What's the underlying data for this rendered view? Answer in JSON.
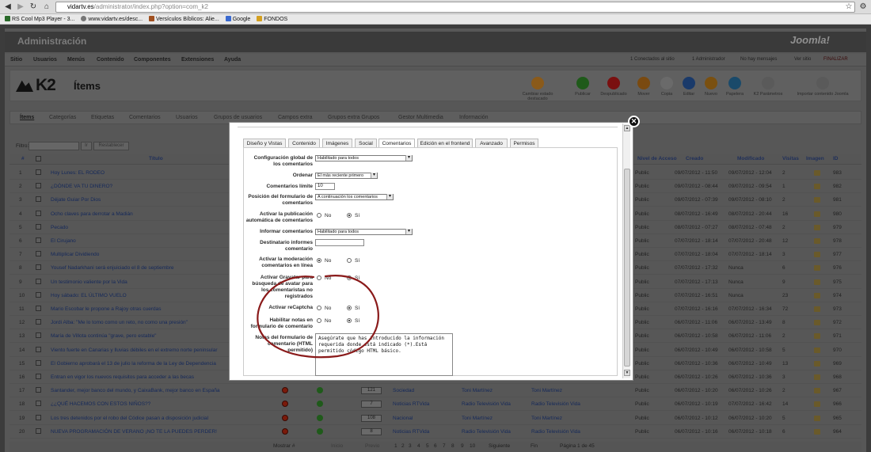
{
  "browser": {
    "url_host": "vidartv.es",
    "url_path": "/administrator/index.php?option=com_k2",
    "back": "◀",
    "forward": "▶",
    "reload": "↻",
    "home": "⌂",
    "star": "☆",
    "wrench": "⚙",
    "bookmarks": [
      "RS Cool Mp3 Player - 3...",
      "www.vidartv.es/desc...",
      "Versículos Bíblicos: Alie...",
      "Google",
      "FONDOS"
    ]
  },
  "admin": {
    "title": "Administración",
    "logo": "Joomla!",
    "menu": [
      "Sitio",
      "Usuarios",
      "Menús",
      "Contenido",
      "Componentes",
      "Extensiones",
      "Ayuda"
    ],
    "status": [
      "1 Conectados al sitio",
      "1 Administrador",
      "No hay mensajes",
      "Ver sitio",
      "FINALIZAR"
    ]
  },
  "k2": {
    "logo": "K2",
    "heading": "Ítems",
    "toolbar": [
      {
        "label": "Cambiar estado destacado",
        "color": "#8a5a1a"
      },
      {
        "label": "Publicar",
        "color": "#1f5a1a"
      },
      {
        "label": "Despublicado",
        "color": "#7a1010"
      },
      {
        "label": "Mover",
        "color": "#7a4a10"
      },
      {
        "label": "Copia",
        "color": "#6a6a6a"
      },
      {
        "label": "Editar",
        "color": "#1a3a6a"
      },
      {
        "label": "Nuevo",
        "color": "#7a5010"
      },
      {
        "label": "Papelera",
        "color": "#1a4a6a"
      },
      {
        "label": "K2 Parámetros",
        "color": "#5a5a5a"
      },
      {
        "label": "Importar contenido Joomla",
        "color": "#5a5a5a"
      }
    ],
    "subnav": [
      "Ítems",
      "Categorías",
      "Etiquetas",
      "Comentarios",
      "Usuarios",
      "Grupos de usuarios",
      "Campos extra",
      "Grupos extra Grupos",
      "Gestor Multimedia",
      "Información"
    ],
    "filter_label": "Filtro:",
    "go": "Ir",
    "reset": "Restablecer"
  },
  "table": {
    "headers": {
      "num": "#",
      "title": "Título",
      "access": "Nivel de Acceso",
      "created": "Creado",
      "modified": "Modificado",
      "hits": "Visitas",
      "image": "Imagen",
      "id": "ID"
    },
    "rows": [
      {
        "n": "1",
        "title": "Hoy Lunes: EL RODEO",
        "access": "Public",
        "created": "09/07/2012 - 11:50",
        "modified": "09/07/2012 - 12:04",
        "hits": "2",
        "id": "983"
      },
      {
        "n": "2",
        "title": "¿DÓNDE VA TU DINERO?",
        "access": "Public",
        "created": "09/07/2012 - 08:44",
        "modified": "09/07/2012 - 09:54",
        "hits": "1",
        "id": "982"
      },
      {
        "n": "3",
        "title": "Déjate Guiar Por Dios",
        "access": "Public",
        "created": "09/07/2012 - 07:39",
        "modified": "09/07/2012 - 08:10",
        "hits": "2",
        "id": "981"
      },
      {
        "n": "4",
        "title": "Ocho claves para derrotar a Madián",
        "access": "Public",
        "created": "08/07/2012 - 16:49",
        "modified": "08/07/2012 - 20:44",
        "hits": "16",
        "id": "980"
      },
      {
        "n": "5",
        "title": "Pecado",
        "access": "Public",
        "created": "08/07/2012 - 07:27",
        "modified": "08/07/2012 - 07:48",
        "hits": "2",
        "id": "979"
      },
      {
        "n": "6",
        "title": "El Cirujano",
        "access": "Public",
        "created": "07/07/2012 - 18:14",
        "modified": "07/07/2012 - 20:48",
        "hits": "12",
        "id": "978"
      },
      {
        "n": "7",
        "title": "Multiplicar Dividiendo",
        "access": "Public",
        "created": "07/07/2012 - 18:04",
        "modified": "07/07/2012 - 18:14",
        "hits": "3",
        "id": "977"
      },
      {
        "n": "8",
        "title": "Yousef Nadarkhani será enjuiciado el 8 de septiembre",
        "access": "Public",
        "created": "07/07/2012 - 17:32",
        "modified": "Nunca",
        "hits": "6",
        "id": "976"
      },
      {
        "n": "9",
        "title": "Un testimonio valiente por la Vida",
        "access": "Public",
        "created": "07/07/2012 - 17:13",
        "modified": "Nunca",
        "hits": "9",
        "id": "975"
      },
      {
        "n": "10",
        "title": "Hoy sábado: EL ÚLTIMO VUELO",
        "access": "Public",
        "created": "07/07/2012 - 16:51",
        "modified": "Nunca",
        "hits": "23",
        "id": "974"
      },
      {
        "n": "11",
        "title": "Mario Escobar le propone a Rajoy otras cuerdas",
        "access": "Public",
        "created": "07/07/2012 - 16:16",
        "modified": "07/07/2012 - 16:34",
        "hits": "72",
        "id": "973"
      },
      {
        "n": "12",
        "title": "Jordi Alba: \"Me lo tomo como un reto, no como una presión\"",
        "access": "Public",
        "created": "06/07/2012 - 11:06",
        "modified": "06/07/2012 - 13:49",
        "hits": "8",
        "id": "972"
      },
      {
        "n": "13",
        "title": "María de Villota continúa \"grave, pero estable\"",
        "access": "Public",
        "created": "06/07/2012 - 10:58",
        "modified": "06/07/2012 - 11:06",
        "hits": "2",
        "id": "971"
      },
      {
        "n": "14",
        "title": "Viento fuerte en Canarias y lluvias débiles en el extremo norte peninsular",
        "access": "Public",
        "created": "06/07/2012 - 10:49",
        "modified": "06/07/2012 - 10:58",
        "hits": "5",
        "id": "970"
      },
      {
        "n": "15",
        "title": "El Gobierno aprobará el 13 de julio la reforma de la Ley de Dependencia",
        "access": "Public",
        "created": "06/07/2012 - 10:36",
        "modified": "06/07/2012 - 10:49",
        "hits": "13",
        "id": "969"
      },
      {
        "n": "16",
        "title": "Entran en vigor los nuevos requisitos para acceder a las becas",
        "access": "Public",
        "created": "06/07/2012 - 10:26",
        "modified": "06/07/2012 - 10:36",
        "hits": "3",
        "id": "968"
      },
      {
        "n": "17",
        "title": "Santander, mejor banco del mundo, y CaixaBank, mejor banco en España",
        "access": "Public",
        "created": "06/07/2012 - 10:20",
        "modified": "06/07/2012 - 10:26",
        "hits": "2",
        "id": "967",
        "counter": "121",
        "category": "Sociedad",
        "author": "Toni Martínez",
        "modby": "Toni Martínez"
      },
      {
        "n": "18",
        "title": "¿¿QUÉ HACEMOS CON ESTOS NIÑOS??",
        "access": "Public",
        "created": "06/07/2012 - 10:19",
        "modified": "07/07/2012 - 16:42",
        "hits": "14",
        "id": "966",
        "counter": "7",
        "category": "Noticias RTVida",
        "author": "Radio Televisión Vida",
        "modby": "Radio Televisión Vida"
      },
      {
        "n": "19",
        "title": "Los tres detenidos por el robo del Códice pasan a disposición judicial",
        "access": "Public",
        "created": "06/07/2012 - 10:12",
        "modified": "06/07/2012 - 10:20",
        "hits": "5",
        "id": "965",
        "counter": "108",
        "category": "Nacional",
        "author": "Toni Martínez",
        "modby": "Toni Martínez"
      },
      {
        "n": "20",
        "title": "NUEVA PROGRAMACIÓN DE VERANO ¡NO TE LA PUEDES PERDER!",
        "access": "Public",
        "created": "06/07/2012 - 10:16",
        "modified": "06/07/2012 - 10:18",
        "hits": "6",
        "id": "964",
        "counter": "8",
        "category": "Noticias RTVida",
        "author": "Radio Televisión Vida",
        "modby": "Radio Televisión Vida"
      }
    ]
  },
  "pager": {
    "show": "Mostrar #",
    "start": "Inicio",
    "prev": "Previo",
    "pages": [
      "1",
      "2",
      "3",
      "4",
      "5",
      "6",
      "7",
      "8",
      "9",
      "10"
    ],
    "next": "Siguiente",
    "end": "Fin",
    "page_of": "Página 1 de 45"
  },
  "modal": {
    "close": "✕",
    "tabs": [
      "Diseño y Vistas",
      "Contenido",
      "Imágenes",
      "Social",
      "Comentarios",
      "Edición en el frontend",
      "Avanzado",
      "Permisos"
    ],
    "active_tab": "Comentarios",
    "fields": {
      "global_label": "Configuración global de los comentarios",
      "global_value": "Habilitado para todos",
      "order_label": "Ordenar",
      "order_value": "El más reciente primero",
      "limit_label": "Comentarios límite",
      "limit_value": "10",
      "position_label": "Posición del formulario de comentarios",
      "position_value": "A continuación los comentarios",
      "autopublish_label": "Activar la publicación automática de comentarios",
      "report_label": "Informar comentarios",
      "report_value": "Habilitado para todos",
      "recipient_label": "Destinatario informes comentario",
      "moderation_label": "Activar la moderación comentarios en línea",
      "gravatar_label": "Activar Gravatar para búsqueda de avatar para los comentaristas no registrados",
      "recaptcha_label": "Activar reCaptcha",
      "notes_label": "Habilitar notas en formulario de comentario",
      "intro_label": "Notas del formulario de comentario (HTML permitido)",
      "intro_value": "Asegúrate que has introducido la información requerida donde está indicado (*).Está permitido código HTML básico.",
      "no": "No",
      "yes": "Sí"
    }
  },
  "annotation": {
    "color": "#8a1a1a"
  }
}
